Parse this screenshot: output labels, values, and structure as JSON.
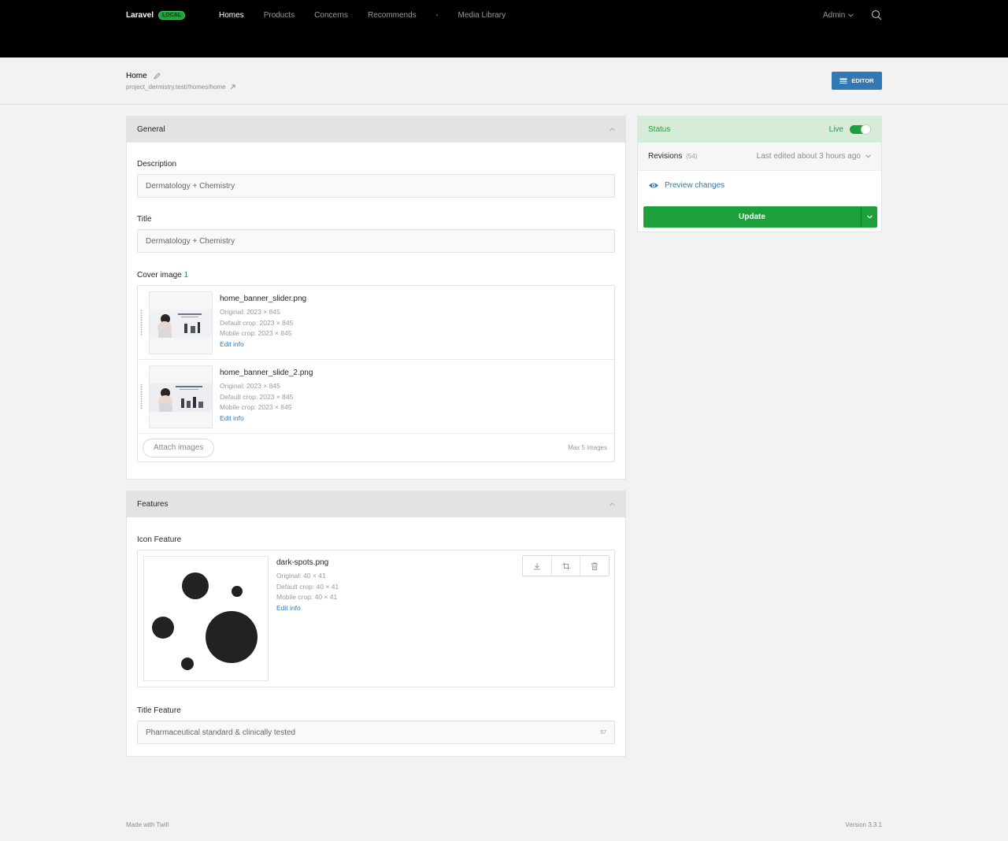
{
  "nav": {
    "brand": "Laravel",
    "env_badge": "LOCAL",
    "links": [
      "Homes",
      "Products",
      "Concerns",
      "Recommends"
    ],
    "dot": "•",
    "media_library": "Media Library",
    "user": "Admin",
    "search_icon": "search-icon"
  },
  "header": {
    "title": "Home",
    "url": "project_dermistry.test//homes/home",
    "editor_label": "EDITOR"
  },
  "general": {
    "heading": "General",
    "description_label": "Description",
    "description_value": "Dermatology + Chemistry",
    "title_label": "Title",
    "title_value": "Dermatology + Chemistry",
    "cover_label": "Cover image",
    "cover_count": "1",
    "images": [
      {
        "name": "home_banner_slider.png",
        "original": "Original: 2023 × 845",
        "default_crop": "Default crop: 2023 × 845",
        "mobile_crop": "Mobile crop: 2023 × 845",
        "edit": "Edit info"
      },
      {
        "name": "home_banner_slide_2.png",
        "original": "Original: 2023 × 845",
        "default_crop": "Default crop: 2023 × 845",
        "mobile_crop": "Mobile crop: 2023 × 845",
        "edit": "Edit info"
      }
    ],
    "attach_label": "Attach images",
    "max_note": "Max 5 images"
  },
  "features": {
    "heading": "Features",
    "icon_label": "Icon Feature",
    "icon_file": {
      "name": "dark-spots.png",
      "original": "Original: 40 × 41",
      "default_crop": "Default crop: 40 × 41",
      "mobile_crop": "Mobile crop: 40 × 41",
      "edit": "Edit info"
    },
    "title_label": "Title Feature",
    "title_value": "Pharmaceutical standard & clinically tested",
    "title_count": "57"
  },
  "status": {
    "heading": "Status",
    "live_label": "Live",
    "live_on": true,
    "revisions_label": "Revisions",
    "revisions_count": "(54)",
    "last_edited": "Last edited about 3 hours ago",
    "preview_label": "Preview changes",
    "update_label": "Update"
  },
  "footer": {
    "made_with": "Made with Twill",
    "version": "Version 3.3.1"
  },
  "colors": {
    "nav_bg": "#000000",
    "accent_green": "#1d9f3c",
    "accent_blue": "#3278b5",
    "status_bg": "#d6ecd8"
  }
}
